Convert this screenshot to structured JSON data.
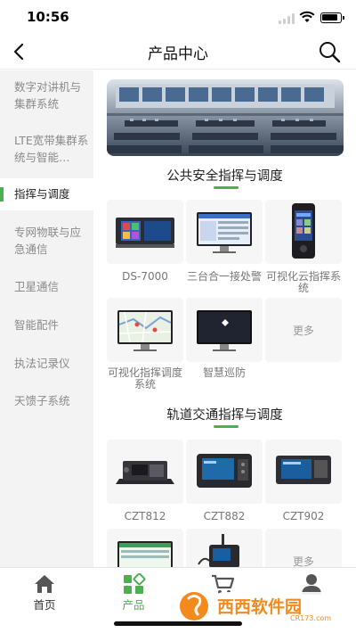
{
  "status": {
    "time": "10:56"
  },
  "nav": {
    "title": "产品中心"
  },
  "sidebar": {
    "items": [
      {
        "label": "数字对讲机与集群系统"
      },
      {
        "label": "LTE宽带集群系统与智能…"
      },
      {
        "label": "指挥与调度",
        "active": true
      },
      {
        "label": "专网物联与应急通信"
      },
      {
        "label": "卫星通信"
      },
      {
        "label": "智能配件"
      },
      {
        "label": "执法记录仪"
      },
      {
        "label": "天馈子系统"
      }
    ]
  },
  "sections": [
    {
      "title": "公共安全指挥与调度",
      "items": [
        {
          "label": "DS-7000"
        },
        {
          "label": "三台合一接处警"
        },
        {
          "label": "可视化云指挥系统"
        },
        {
          "label": "可视化指挥调度系统"
        },
        {
          "label": "智慧巡防"
        },
        {
          "label": "更多"
        }
      ]
    },
    {
      "title": "轨道交通指挥与调度",
      "items": [
        {
          "label": "CZT812"
        },
        {
          "label": "CZT882"
        },
        {
          "label": "CZT902"
        },
        {
          "label": ""
        },
        {
          "label": ""
        },
        {
          "label": "更多"
        }
      ]
    }
  ],
  "tabbar": {
    "items": [
      {
        "label": "首页",
        "icon": "home-icon"
      },
      {
        "label": "产品",
        "icon": "grid-icon",
        "active": true
      },
      {
        "label": "",
        "icon": "cart-icon"
      },
      {
        "label": "",
        "icon": "user-icon"
      }
    ]
  },
  "watermark": {
    "text": "西西软件园",
    "sub": "CR173.com"
  },
  "colors": {
    "accent": "#4caf50",
    "sidebar_bg": "#f3f3f3",
    "tile_bg": "#f6f6f6",
    "watermark_orange": "#f28a1e"
  }
}
